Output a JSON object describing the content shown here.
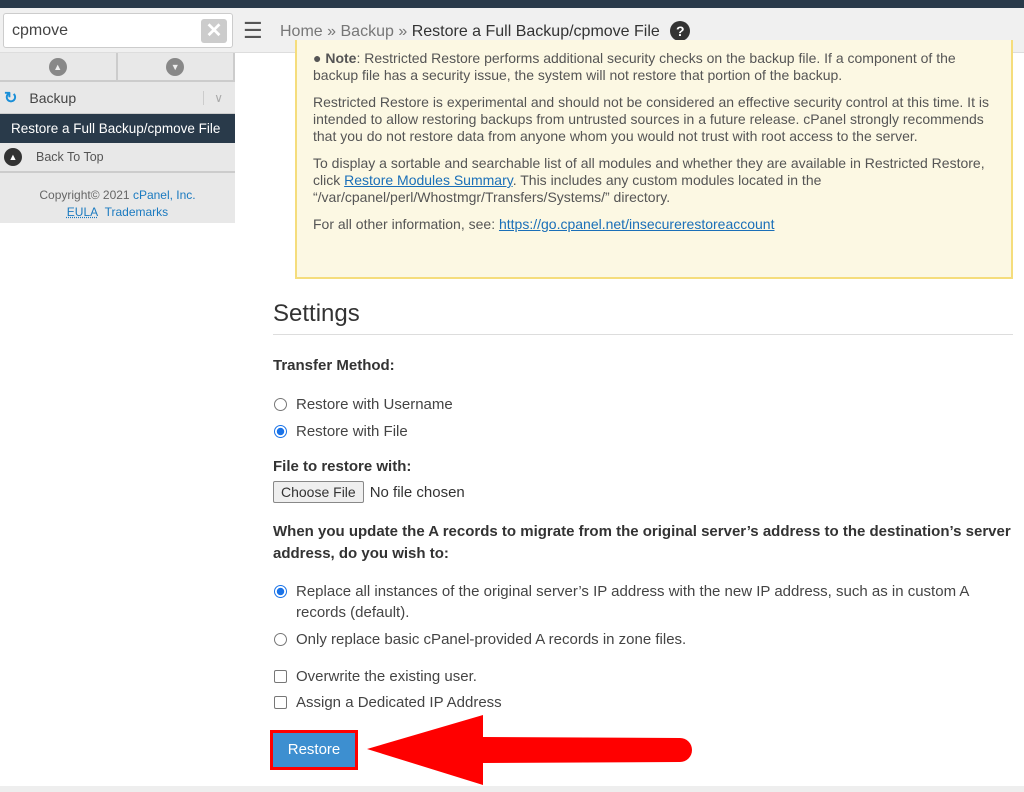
{
  "search": {
    "value": "cpmove"
  },
  "breadcrumb": {
    "home": "Home",
    "sep": "»",
    "section": "Backup",
    "current": "Restore a Full Backup/cpmove File",
    "help": "?"
  },
  "sidebar": {
    "group": "Backup",
    "active_item": "Restore a Full Backup/cpmove File",
    "back_to_top": "Back To Top",
    "copyright": "Copyright© 2021",
    "company": "cPanel, Inc.",
    "eula": "EULA",
    "trademarks": "Trademarks"
  },
  "note": {
    "label": "Note",
    "p1": ": Restricted Restore performs additional security checks on the backup file. If a component of the backup file has a security issue, the system will not restore that portion of the backup.",
    "p2": "Restricted Restore is experimental and should not be considered an effective security control at this time. It is intended to allow restoring backups from untrusted sources in a future release. cPanel strongly recommends that you do not restore data from anyone whom you would not trust with root access to the server.",
    "p3a": "To display a sortable and searchable list of all modules and whether they are available in Restricted Restore, click ",
    "p3link": "Restore Modules Summary",
    "p3b": ". This includes any custom modules located in the “/var/cpanel/perl/Whostmgr/Transfers/Systems/” directory.",
    "p4a": "For all other information, see: ",
    "p4link": "https://go.cpanel.net/insecurerestoreaccount"
  },
  "settings": {
    "title": "Settings",
    "transfer_label": "Transfer Method:",
    "transfer_options": [
      "Restore with Username",
      "Restore with File"
    ],
    "transfer_selected": "Restore with File",
    "file_label": "File to restore with:",
    "choose_file": "Choose File",
    "no_file": "No file chosen",
    "arecords_label": "When you update the A records to migrate from the original server’s address to the destination’s server address, do you wish to:",
    "arecords_options": [
      "Replace all instances of the original server’s IP address with the new IP address, such as in custom A records (default).",
      "Only replace basic cPanel-provided A records in zone files."
    ],
    "arecords_selected": 0,
    "overwrite": "Overwrite the existing user.",
    "overwrite_checked": false,
    "dedicated_ip": "Assign a Dedicated IP Address",
    "dedicated_ip_checked": false,
    "restore_button": "Restore"
  },
  "colors": {
    "accent": "#3d8fd0",
    "annotation_arrow": "#ff0000",
    "nav_dark": "#293a4a"
  }
}
